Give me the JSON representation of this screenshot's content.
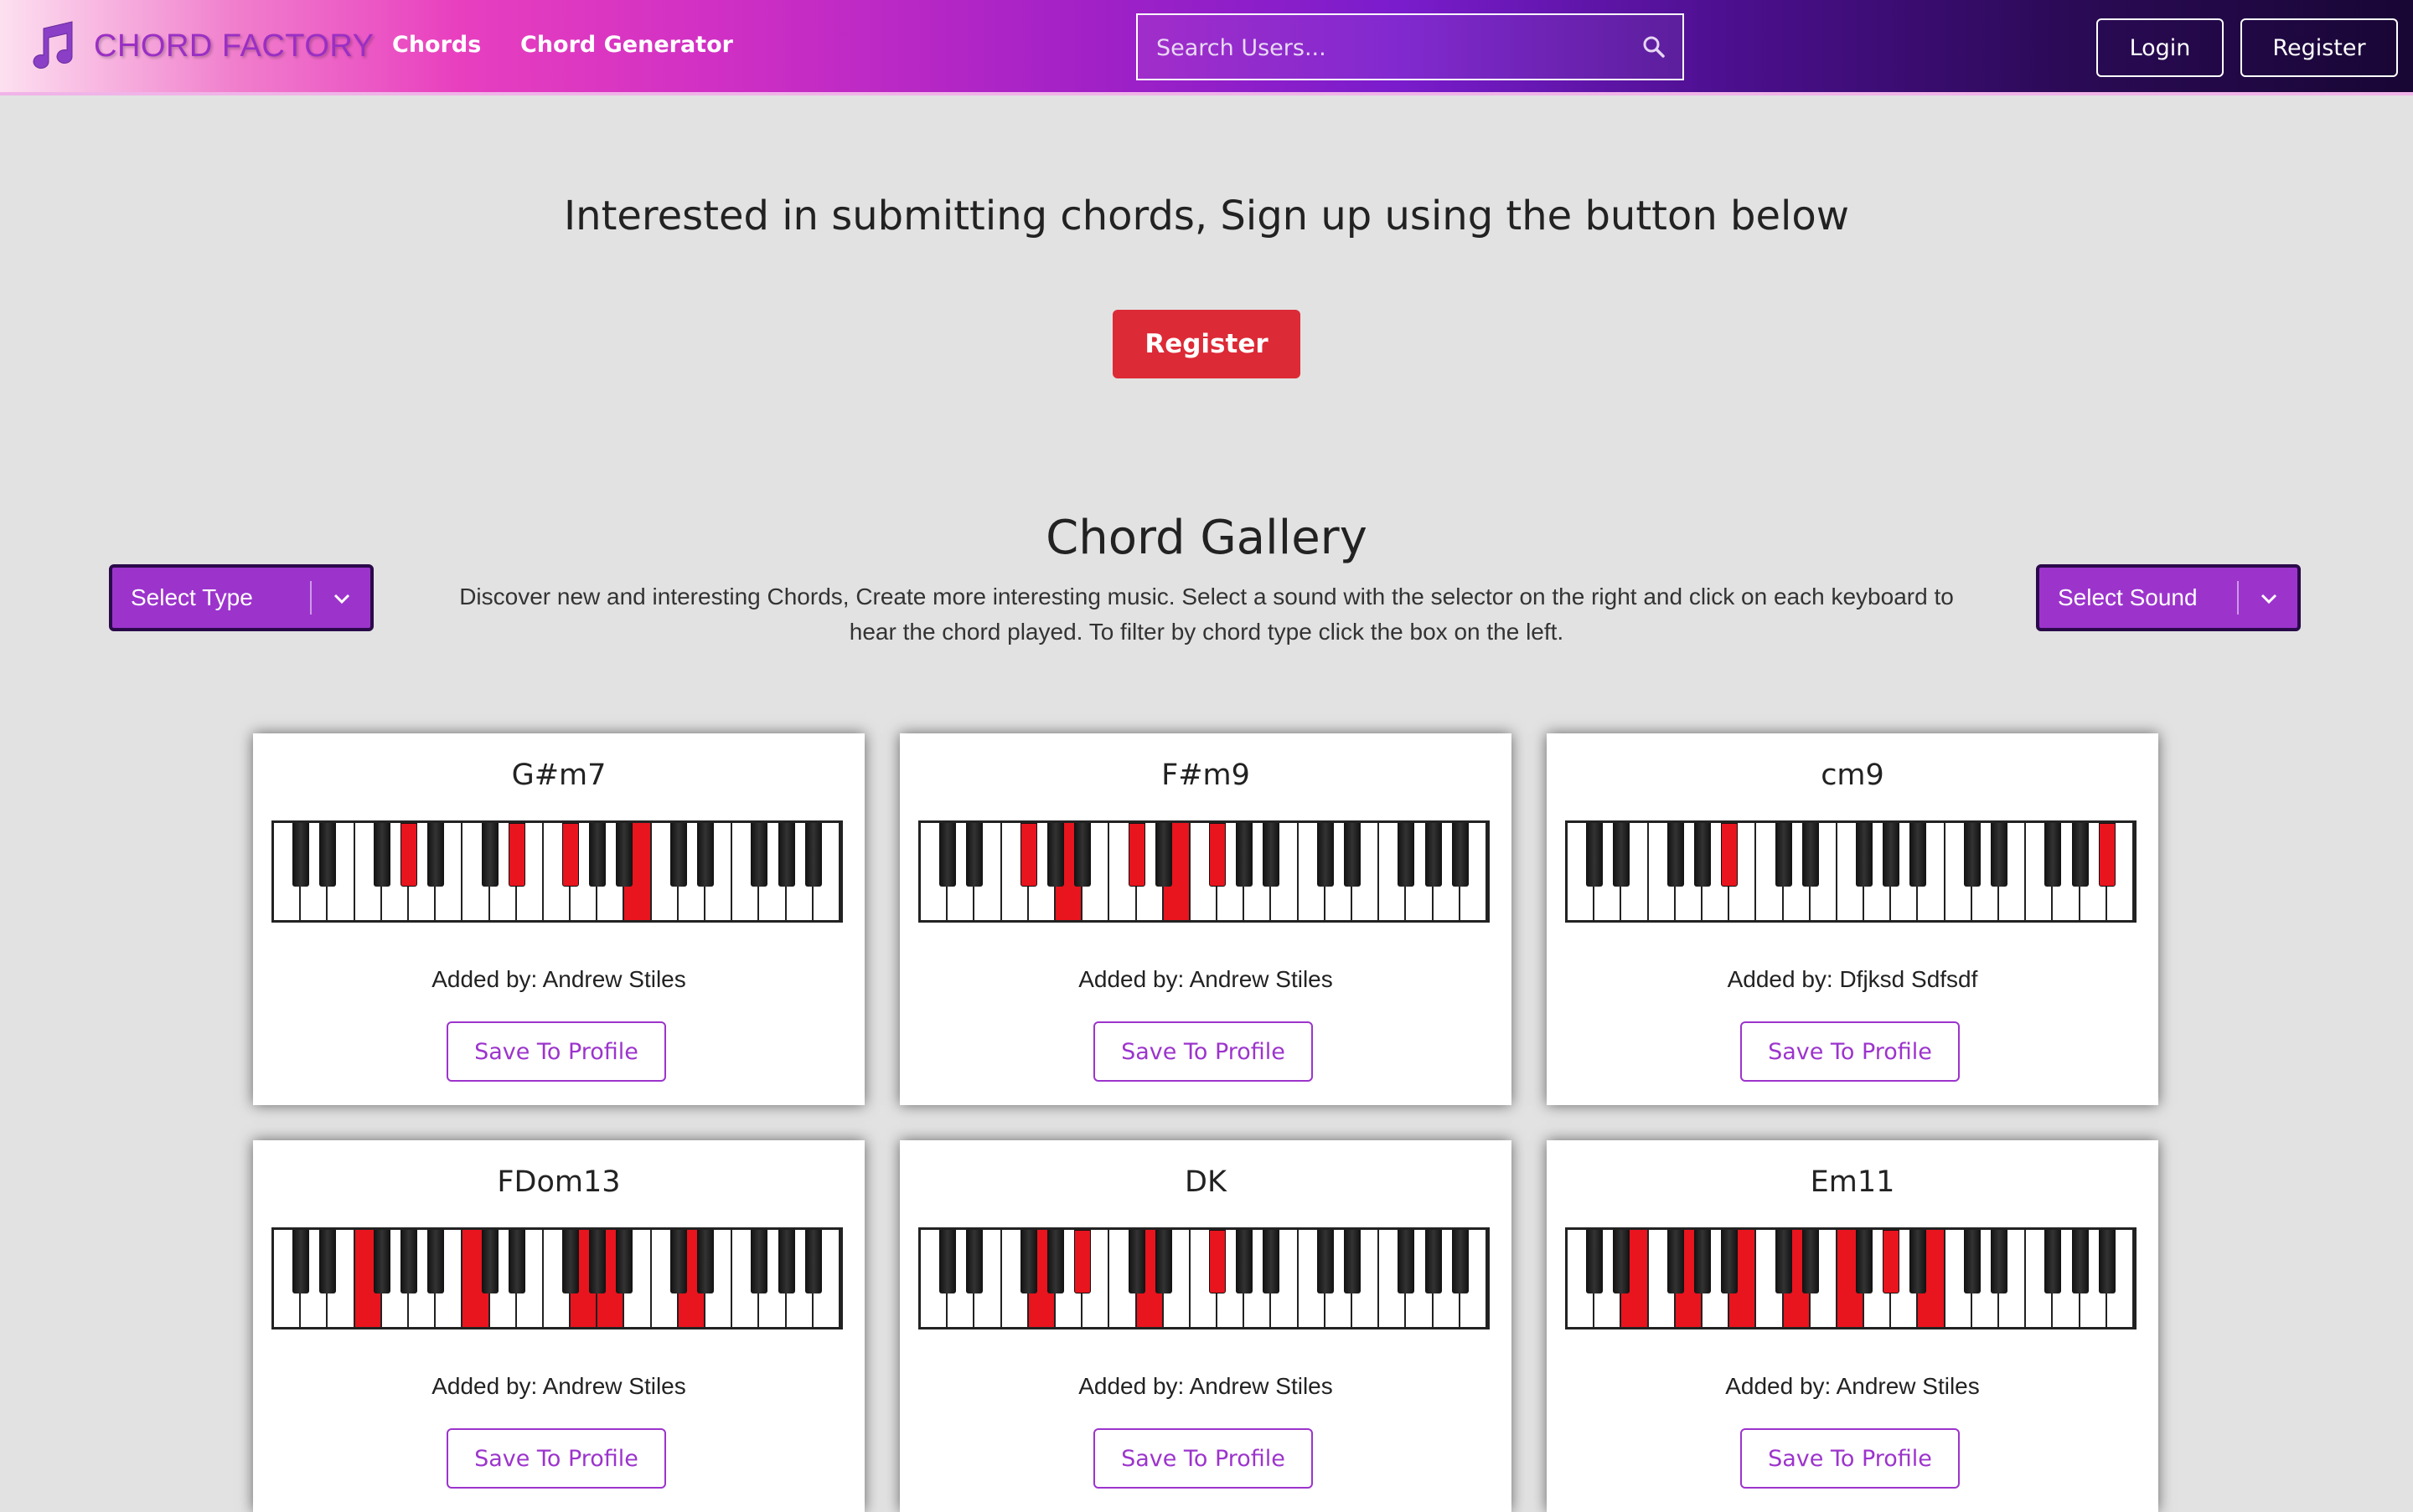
{
  "header": {
    "brand": "CHORD FACTORY",
    "nav": [
      "Chords",
      "Chord Generator"
    ],
    "search_placeholder": "Search Users...",
    "login_label": "Login",
    "register_label": "Register",
    "logo_icon": "music-note-icon",
    "gradient_colors": [
      "#fde0f0",
      "#e83fbf",
      "#7a1ccc",
      "#180634"
    ]
  },
  "hero": {
    "text": "Interested in submitting chords, Sign up using the button below",
    "button_label": "Register",
    "button_color": "#dc2a36"
  },
  "gallery": {
    "title": "Chord Gallery",
    "description": "Discover new and interesting Chords, Create more interesting music. Select a sound with the selector on the right and click on each keyboard to hear the chord played. To filter by chord type click the box on the left.",
    "select_type_label": "Select Type",
    "select_sound_label": "Select Sound",
    "accent_color": "#9c34cc"
  },
  "cards": [
    {
      "name": "G#m7",
      "added_by": "Added by: Andrew Stiles",
      "save_label": "Save To Profile",
      "white_on": [
        13
      ],
      "black_on": [
        3,
        6,
        7
      ]
    },
    {
      "name": "F#m9",
      "added_by": "Added by: Andrew Stiles",
      "save_label": "Save To Profile",
      "white_on": [
        5,
        9
      ],
      "black_on": [
        2,
        5,
        7
      ]
    },
    {
      "name": "cm9",
      "added_by": "Added by: Dfjksd Sdfsdf",
      "save_label": "Save To Profile",
      "white_on": [],
      "black_on": [
        4,
        14
      ]
    },
    {
      "name": "FDom13",
      "added_by": "Added by: Andrew Stiles",
      "save_label": "Save To Profile",
      "white_on": [
        3,
        7,
        11,
        12,
        15
      ],
      "black_on": []
    },
    {
      "name": "DK",
      "added_by": "Added by: Andrew Stiles",
      "save_label": "Save To Profile",
      "white_on": [
        4,
        8
      ],
      "black_on": [
        4,
        7
      ]
    },
    {
      "name": "Em11",
      "added_by": "Added by: Andrew Stiles",
      "save_label": "Save To Profile",
      "white_on": [
        2,
        4,
        6,
        8,
        10,
        13
      ],
      "black_on": [
        8
      ]
    }
  ]
}
